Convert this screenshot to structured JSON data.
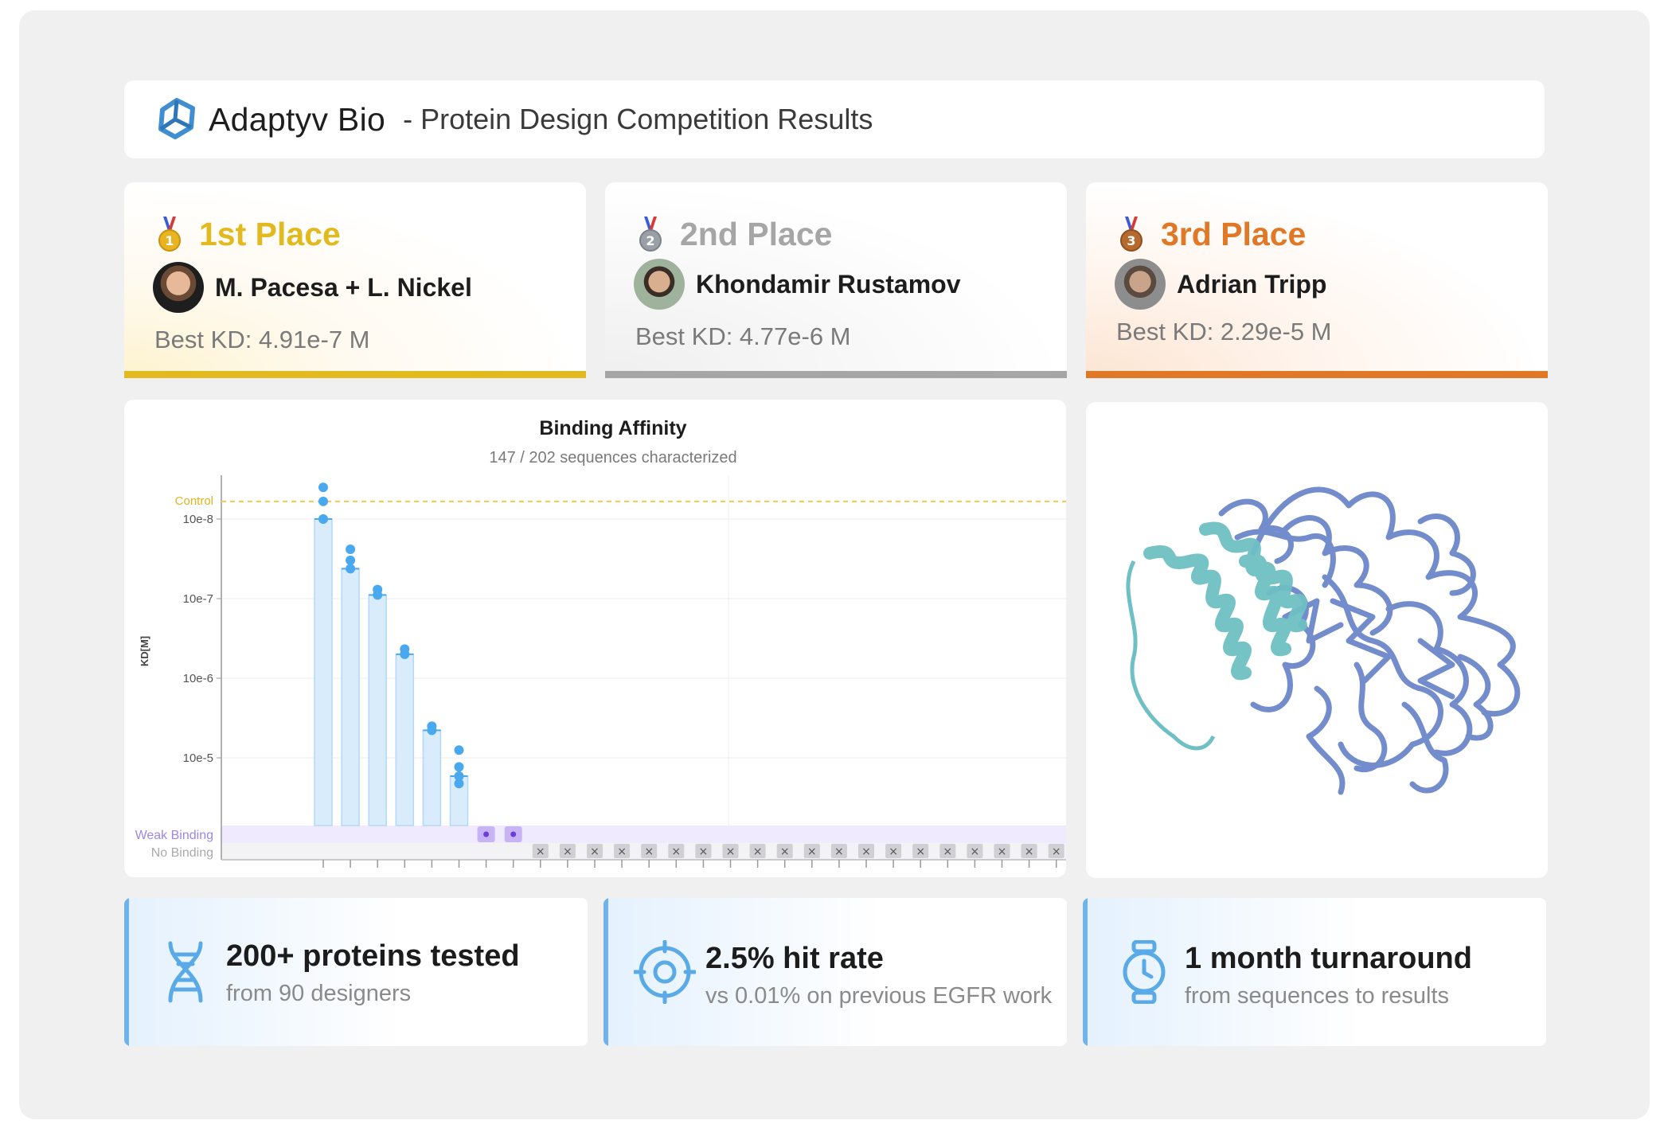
{
  "header": {
    "brand": "Adaptyv Bio",
    "subtitle": "- Protein Design Competition Results"
  },
  "places": [
    {
      "title": "1st Place",
      "name": "M. Pacesa + L. Nickel",
      "best_kd": "Best KD: 4.91e-7 M",
      "medal_number": "1",
      "color": "#e2b91f"
    },
    {
      "title": "2nd Place",
      "name": "Khondamir Rustamov",
      "best_kd": "Best KD: 4.77e-6 M",
      "medal_number": "2",
      "color": "#a6a6a6"
    },
    {
      "title": "3rd Place",
      "name": "Adrian Tripp",
      "best_kd": "Best KD: 2.29e-5 M",
      "medal_number": "3",
      "color": "#e07826"
    }
  ],
  "chart_data": {
    "type": "bar",
    "title": "Binding Affinity",
    "subtitle": "147 / 202 sequences characterized",
    "ylabel": "KD[M]",
    "y_scale": "log (inverted)",
    "y_tick_labels": [
      "10e-8",
      "10e-7",
      "10e-6",
      "10e-5"
    ],
    "control_label": "Control",
    "control_kd": 6e-09,
    "weak_binding_label": "Weak Binding",
    "no_binding_label": "No Binding",
    "series": [
      {
        "values": [
          1e-08,
          4.2e-08,
          9e-08,
          5e-07,
          4.5e-06,
          1.7e-05
        ]
      }
    ],
    "points": [
      [
        4e-09,
        6e-09,
        1e-08
      ],
      [
        2.4e-08,
        3.3e-08,
        4.2e-08
      ],
      [
        7.7e-08,
        9e-08
      ],
      [
        4.3e-07,
        5e-07
      ],
      [
        4e-06,
        4.5e-06
      ],
      [
        8e-06,
        1.3e-05,
        1.7e-05,
        2.1e-05
      ]
    ],
    "weak_binding_count": 2,
    "no_binding_count": 20,
    "colors": {
      "bar": "#d8ecfb",
      "bar_edge": "#b5d8f6",
      "point": "#4aa8ef",
      "control": "#f2c94c",
      "weak": "#c8b4f5",
      "weak_band": "#efeafd",
      "no_band": "#f3f3f5",
      "x_marker": "#cfcfd4"
    }
  },
  "stats": [
    {
      "icon": "dna-icon",
      "title": "200+ proteins tested",
      "subtitle": "from 90 designers"
    },
    {
      "icon": "target-icon",
      "title": "2.5% hit rate",
      "subtitle": "vs 0.01% on previous EGFR work"
    },
    {
      "icon": "stopwatch-icon",
      "title": "1 month turnaround",
      "subtitle": "from sequences to results"
    }
  ],
  "colors": {
    "accent_blue": "#6fb3ea",
    "frame": "#f0f0f0",
    "protein_teal": "#6fc0c4",
    "protein_blue": "#6c86c9"
  }
}
